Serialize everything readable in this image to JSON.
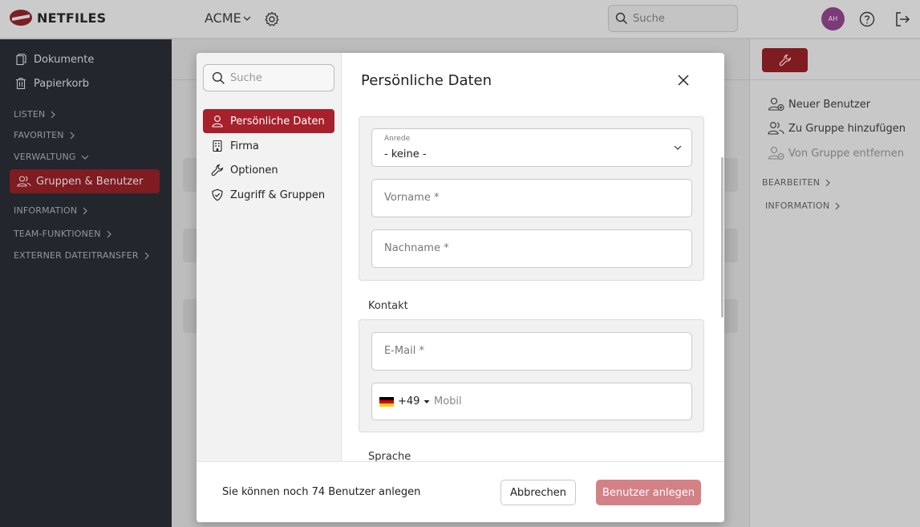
{
  "topbar": {
    "logo_text": "NETFILES",
    "tenant": "ACME",
    "search_placeholder": "Suche",
    "avatar_initials": "AH"
  },
  "sidebar": {
    "items": [
      {
        "label": "Dokumente",
        "icon": "document-icon"
      },
      {
        "label": "Papierkorb",
        "icon": "trash-icon"
      }
    ],
    "sections": {
      "listen": "LISTEN",
      "favoriten": "FAVORITEN",
      "verwaltung": "VERWALTUNG",
      "information": "INFORMATION",
      "team": "TEAM-FUNKTIONEN",
      "externer": "EXTERNER DATEITRANSFER"
    },
    "active_item": "Gruppen & Benutzer"
  },
  "right_panel": {
    "actions": [
      {
        "label": "Neuer Benutzer",
        "enabled": true
      },
      {
        "label": "Zu Gruppe hinzufügen",
        "enabled": true
      },
      {
        "label": "Von Gruppe entfernen",
        "enabled": false
      }
    ],
    "sections": {
      "bearbeiten": "BEARBEITEN",
      "information": "INFORMATION"
    }
  },
  "modal": {
    "search_placeholder": "Suche",
    "nav": [
      {
        "label": "Persönliche Daten",
        "icon": "user-icon",
        "active": true
      },
      {
        "label": "Firma",
        "icon": "building-icon",
        "active": false
      },
      {
        "label": "Optionen",
        "icon": "wrench-icon",
        "active": false
      },
      {
        "label": "Zugriff & Gruppen",
        "icon": "shield-check-icon",
        "active": false
      }
    ],
    "title": "Persönliche Daten",
    "personal": {
      "salutation_label": "Anrede",
      "salutation_value": "- keine -",
      "firstname_placeholder": "Vorname *",
      "lastname_placeholder": "Nachname *"
    },
    "contact": {
      "title": "Kontakt",
      "email_placeholder": "E-Mail *",
      "phone_prefix": "+49",
      "mobile_placeholder": "Mobil"
    },
    "language_title": "Sprache",
    "footer": {
      "info": "Sie können noch 74 Benutzer anlegen",
      "cancel": "Abbrechen",
      "create": "Benutzer anlegen"
    }
  },
  "colors": {
    "accent": "#a6212b",
    "accent_disabled": "#d48186",
    "sidebar_bg": "#23262d"
  }
}
